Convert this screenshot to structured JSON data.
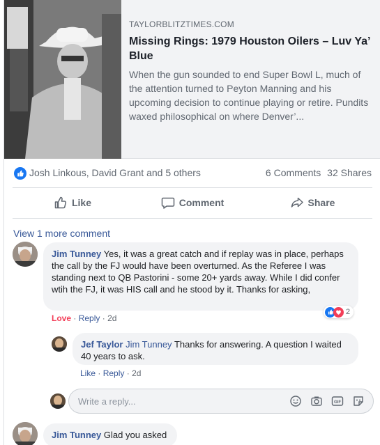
{
  "preview": {
    "domain": "TAYLORBLITZTIMES.COM",
    "headline": "Missing Rings: 1979 Houston Oilers – Luv Ya’ Blue",
    "excerpt": "When the gun sounded to end Super Bowl L, much of the attention turned to Peyton Manning and his upcoming decision to continue playing or retire. Pundits waxed philosophical on where Denver’..."
  },
  "summary": {
    "names": "Josh Linkous, David Grant and 5 others",
    "comments": "6 Comments",
    "shares": "32 Shares"
  },
  "actions": {
    "like": "Like",
    "comment": "Comment",
    "share": "Share"
  },
  "view_more": "View 1 more comment",
  "comments": [
    {
      "author": "Jim Tunney",
      "text": "Yes, it was a great catch and if replay was in place, perhaps the call by the FJ would have been overturned. As the Referee I was standing next to QB Pastorini - some 20+ yards away. While I did confer wtih the FJ, it was HIS call and he stood by it. Thanks for asking,",
      "reaction_label": "Love",
      "reply_label": "Reply",
      "time": "2d",
      "reaction_count": "2"
    },
    {
      "author": "Jef Taylor",
      "mention": "Jim Tunney",
      "text": "Thanks for answering. A question I waited 40 years to ask.",
      "like_label": "Like",
      "reply_label": "Reply",
      "time": "2d"
    },
    {
      "author": "Jim Tunney",
      "text": "Glad you asked"
    }
  ],
  "reply_box": {
    "placeholder": "Write a reply..."
  },
  "colors": {
    "link": "#385898",
    "like_blue": "#1877f2",
    "love_red": "#f33e58",
    "bubble": "#f2f3f5"
  },
  "icons": [
    "like-icon",
    "comment-icon",
    "share-icon",
    "emoji-icon",
    "camera-icon",
    "gif-icon",
    "sticker-icon"
  ]
}
